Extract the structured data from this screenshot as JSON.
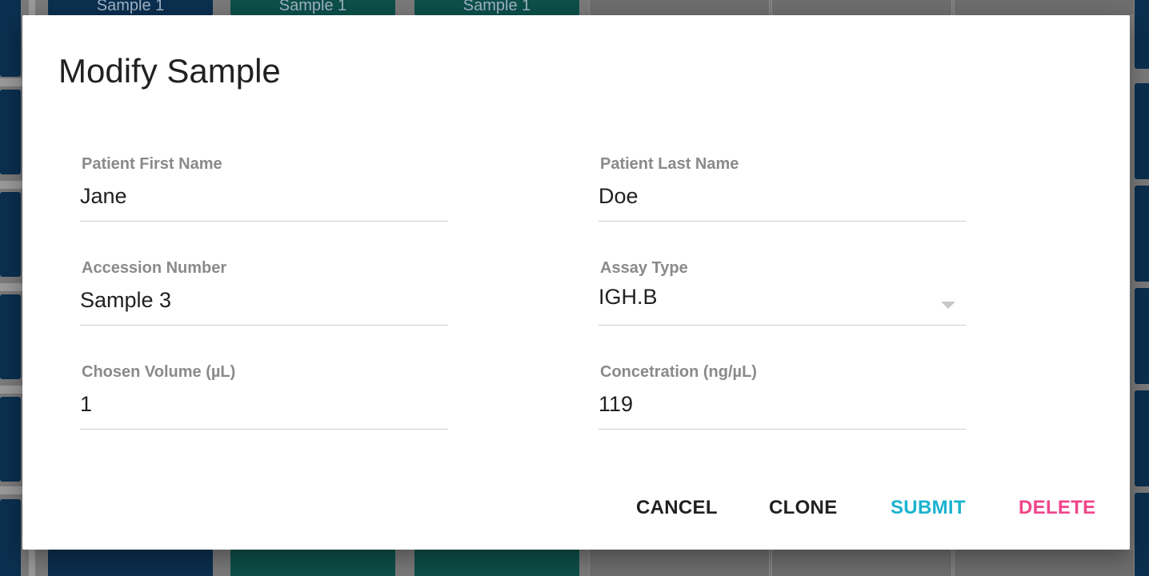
{
  "background": {
    "sample_labels": [
      "Sample 1",
      "Sample 1",
      "Sample 1"
    ]
  },
  "dialog": {
    "title": "Modify Sample",
    "fields": {
      "first_name": {
        "label": "Patient First Name",
        "value": "Jane"
      },
      "last_name": {
        "label": "Patient Last Name",
        "value": "Doe"
      },
      "accession": {
        "label": "Accession Number",
        "value": "Sample 3"
      },
      "assay_type": {
        "label": "Assay Type",
        "value": "IGH.B"
      },
      "volume": {
        "label": "Chosen Volume (µL)",
        "value": "1"
      },
      "concentration": {
        "label": "Concetration (ng/µL)",
        "value": "119"
      }
    },
    "actions": {
      "cancel": "CANCEL",
      "clone": "CLONE",
      "submit": "SUBMIT",
      "delete": "DELETE"
    }
  },
  "colors": {
    "submit": "#1ab3cf",
    "delete": "#f0448a",
    "neutral_action": "#212121"
  }
}
